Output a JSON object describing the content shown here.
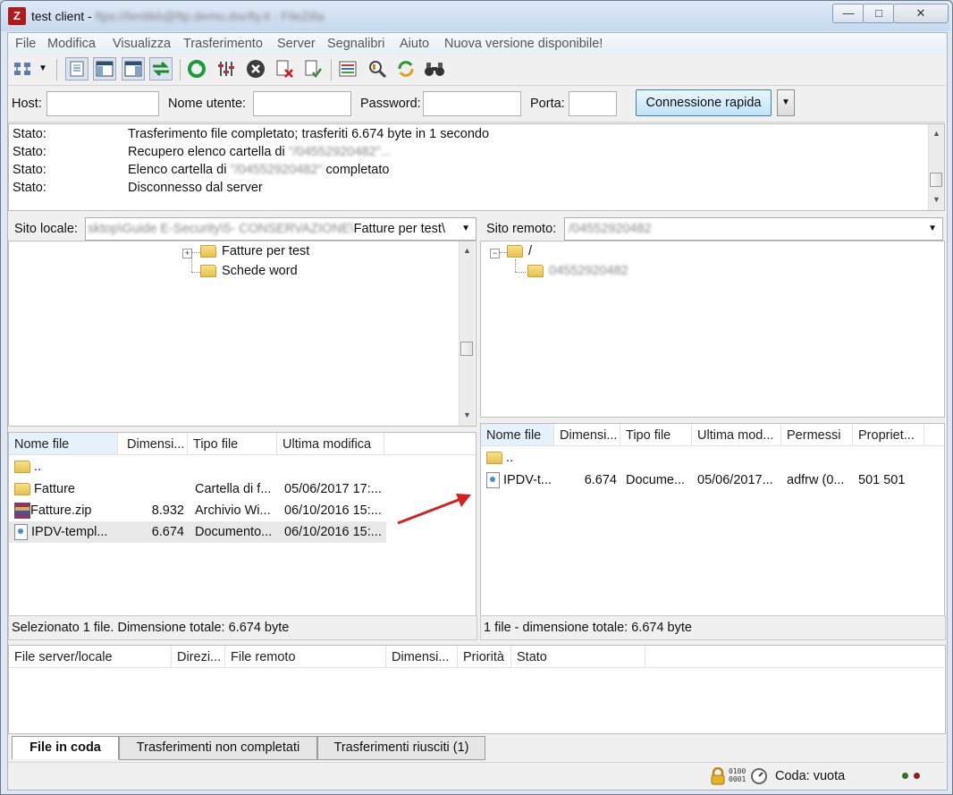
{
  "window": {
    "title": "test client - ",
    "title_blurred": "ftps://ferdikb@ftp.demo.docfly.it - FileZilla",
    "app_icon": "filezilla-icon"
  },
  "menu": [
    "File",
    "Modifica",
    "Visualizza",
    "Trasferimento",
    "Server",
    "Segnalibri",
    "Aiuto",
    "Nuova versione disponibile!"
  ],
  "toolbar": {
    "icons": [
      "site-manager-icon",
      "toggle-log-icon",
      "toggle-local-tree-icon",
      "toggle-remote-tree-icon",
      "toggle-queue-icon",
      "refresh-icon",
      "process-queue-icon",
      "cancel-icon",
      "disconnect-icon",
      "reconnect-icon",
      "filter-icon",
      "compare-icon",
      "sync-browse-icon",
      "search-icon"
    ]
  },
  "quickconnect": {
    "host_label": "Host:",
    "host_value": "",
    "user_label": "Nome utente:",
    "user_value": "",
    "pass_label": "Password:",
    "pass_value": "",
    "port_label": "Porta:",
    "port_value": "",
    "button_label": "Connessione rapida"
  },
  "log": [
    {
      "k": "Stato:",
      "v": "Trasferimento file completato; trasferiti 6.674 byte in 1 secondo",
      "blur": "",
      "tail": ""
    },
    {
      "k": "Stato:",
      "v": "Recupero elenco cartella di ",
      "blur": "\"/04552920482\"...",
      "tail": ""
    },
    {
      "k": "Stato:",
      "v": "Elenco cartella di ",
      "blur": "\"/04552920482\"",
      "tail": " completato"
    },
    {
      "k": "Stato:",
      "v": "Disconnesso dal server",
      "blur": "",
      "tail": ""
    }
  ],
  "local": {
    "path_label": "Sito locale:",
    "path_blurred": "sktop\\Guide E-Security\\5- CONSERVAZIONE\\",
    "path_value": "Fatture per test\\",
    "tree": [
      "Fatture per test",
      "Schede word"
    ],
    "columns": [
      "Nome file",
      "Dimensi...",
      "Tipo file",
      "Ultima modifica"
    ],
    "rows": [
      {
        "name": "..",
        "size": "",
        "type": "",
        "modified": ""
      },
      {
        "name": "Fatture",
        "size": "",
        "type": "Cartella di f...",
        "modified": "05/06/2017 17:..."
      },
      {
        "name": "Fatture.zip",
        "size": "8.932",
        "type": "Archivio Wi...",
        "modified": "06/10/2016 15:..."
      },
      {
        "name": "IPDV-templ...",
        "size": "6.674",
        "type": "Documento...",
        "modified": "06/10/2016 15:..."
      }
    ],
    "status": "Selezionato 1 file. Dimensione totale: 6.674 byte"
  },
  "remote": {
    "path_label": "Sito remoto:",
    "path_value": "/04552920482",
    "tree_root": "/",
    "tree_child": "04552920482",
    "columns": [
      "Nome file",
      "Dimensi...",
      "Tipo file",
      "Ultima mod...",
      "Permessi",
      "Propriet..."
    ],
    "rows": [
      {
        "name": "..",
        "size": "",
        "type": "",
        "modified": "",
        "perms": "",
        "owner": ""
      },
      {
        "name": "IPDV-t...",
        "size": "6.674",
        "type": "Docume...",
        "modified": "05/06/2017...",
        "perms": "adfrw (0...",
        "owner": "501 501"
      }
    ],
    "status": "1 file - dimensione totale: 6.674 byte"
  },
  "queue": {
    "columns": [
      "File server/locale",
      "Direzi...",
      "File remoto",
      "Dimensi...",
      "Priorità",
      "Stato"
    ],
    "tabs": [
      "File in coda",
      "Trasferimenti non completati",
      "Trasferimenti riusciti (1)"
    ],
    "status": "Coda: vuota"
  }
}
